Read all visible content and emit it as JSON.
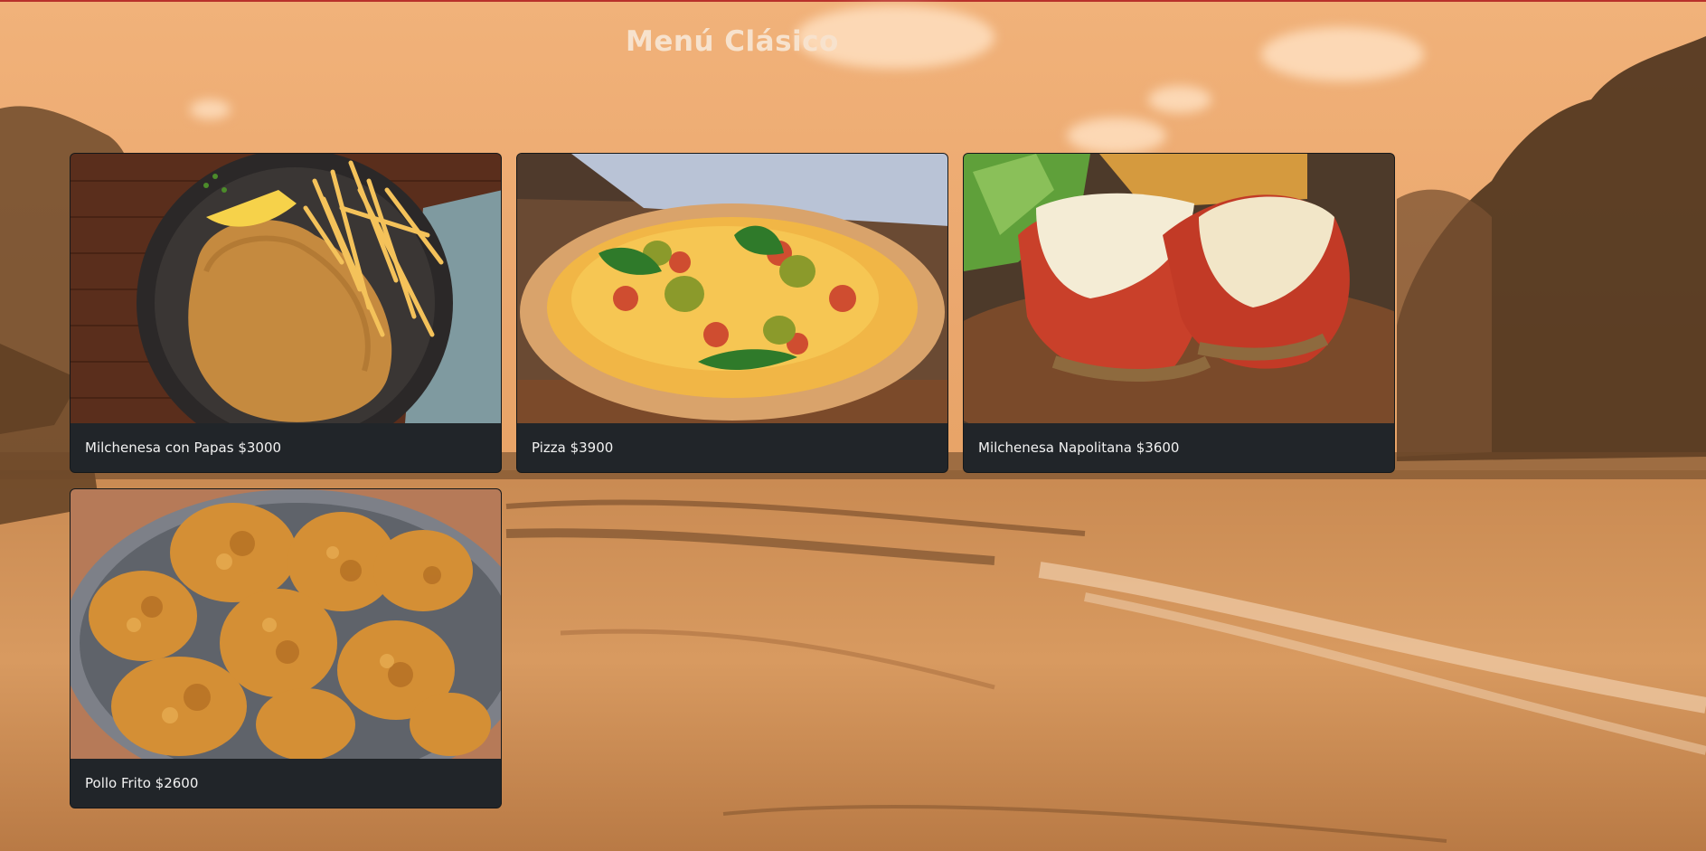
{
  "page": {
    "title": "Menú Clásico",
    "accent_color": "#b8312c",
    "background_tint": "#eaa66c",
    "card_color": "#212529"
  },
  "menu": {
    "items": [
      {
        "label": "Milchenesa con Papas $3000",
        "image": "milanesa-with-fries-photo"
      },
      {
        "label": "Pizza $3900",
        "image": "pizza-photo"
      },
      {
        "label": "Milchenesa Napolitana $3600",
        "image": "milanesa-napolitana-photo"
      },
      {
        "label": "Pollo Frito $2600",
        "image": "fried-chicken-photo"
      }
    ]
  }
}
